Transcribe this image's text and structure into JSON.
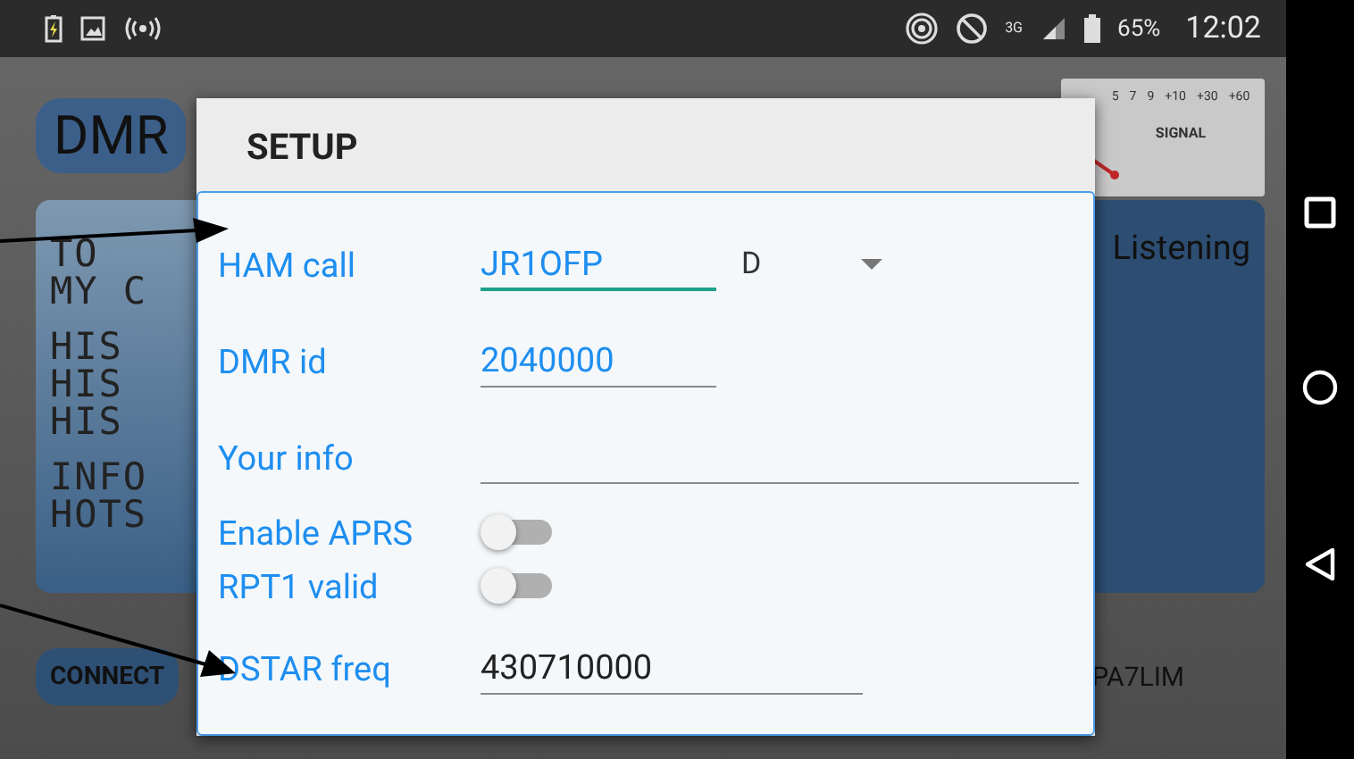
{
  "status_bar": {
    "network": "3G",
    "battery": "65%",
    "time": "12:02"
  },
  "app": {
    "mode_button": "DMR",
    "display_lines": [
      "TO",
      "MY C",
      "HIS",
      "HIS",
      "HIS",
      "INFO",
      "HOTS"
    ],
    "status": "Listening",
    "connect_button": "CONNECT",
    "callsign": "PA7LIM",
    "meter": {
      "label": "SIGNAL",
      "scale": [
        "5",
        "7",
        "9",
        "+10",
        "+30",
        "+60"
      ]
    }
  },
  "dialog": {
    "title": "SETUP",
    "rows": [
      {
        "kind": "text",
        "label": "HAM call",
        "value": "JR1OFP",
        "focused": true,
        "highlighted": true,
        "dropdown": "D"
      },
      {
        "kind": "text",
        "label": "DMR id",
        "value": "2040000",
        "focused": false,
        "highlighted": true
      },
      {
        "kind": "text",
        "label": "Your info",
        "focused": false
      },
      {
        "kind": "toggle",
        "label": "Enable APRS",
        "on": false
      },
      {
        "kind": "toggle",
        "label": "RPT1 valid",
        "on": false
      },
      {
        "kind": "text",
        "label": "DSTAR freq",
        "value": "430710000",
        "focused": false,
        "highlighted": false
      }
    ]
  }
}
